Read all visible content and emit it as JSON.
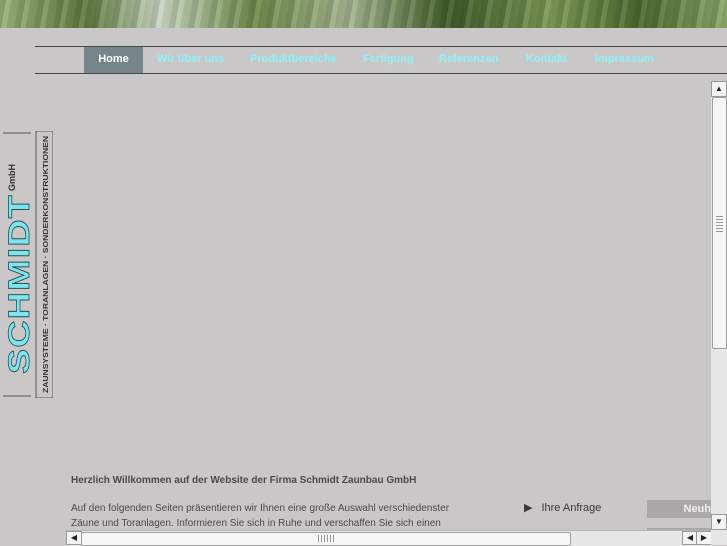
{
  "nav": {
    "items": [
      {
        "label": "Home"
      },
      {
        "label": "Wir über uns"
      },
      {
        "label": "Produktbereiche"
      },
      {
        "label": "Fertigung"
      },
      {
        "label": "Referenzen"
      },
      {
        "label": "Kontakt"
      },
      {
        "label": "Impressum"
      }
    ]
  },
  "logo": {
    "name": "SCHMIDT",
    "suffix": "GmbH",
    "tagline": "ZAUNSYSTEME · TORANLAGEN · SONDERKONSTRUKTIONEN"
  },
  "content": {
    "title": "Herzlich Willkommen auf der Website der Firma Schmidt Zaunbau GmbH",
    "paragraph_line1": "Auf den folgenden Seiten präsentieren wir Ihnen eine große Auswahl verschiedenster",
    "paragraph_line2": "Zäune und Toranlagen. Informieren Sie sich in Ruhe und verschaffen Sie sich einen"
  },
  "sidebar": {
    "anfrage_label": "Ihre Anfrage",
    "neu_label": "Neuh"
  },
  "colors": {
    "background": "#cac7c8",
    "nav_text": "#8ff3f5",
    "nav_active_bg": "#76858a",
    "logo_cyan": "#7ee6ef"
  }
}
